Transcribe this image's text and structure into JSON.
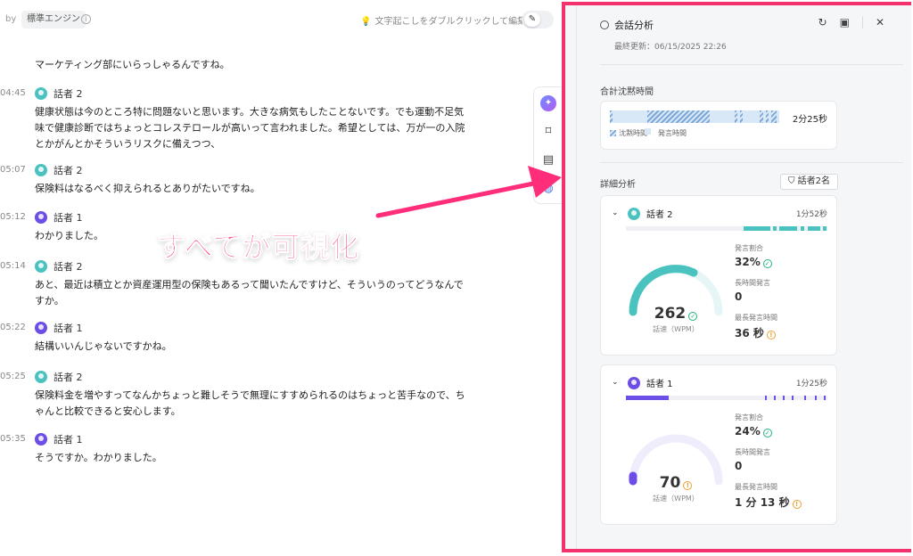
{
  "topbar": {
    "by_label": "by",
    "engine": "標準エンジン",
    "info_icon": "info-icon",
    "hint": "文字起こしをダブルクリックして編集",
    "edit_icon": "pencil-icon"
  },
  "transcript": [
    {
      "time": "",
      "speaker": "",
      "avatar": "",
      "text": "マーケティング部にいらっしゃるんですね。"
    },
    {
      "time": "04:45",
      "speaker": "話者 2",
      "avatar": "s2",
      "text": "健康状態は今のところ特に問題ないと思います。大きな病気もしたことないです。でも運動不足気味で健康診断ではちょっとコレステロールが高いって言われました。希望としては、万が一の入院とかがんとかそういうリスクに備えつつ、"
    },
    {
      "time": "05:07",
      "speaker": "話者 2",
      "avatar": "s2",
      "text": "保険料はなるべく抑えられるとありがたいですね。"
    },
    {
      "time": "05:12",
      "speaker": "話者 1",
      "avatar": "s1",
      "text": "わかりました。"
    },
    {
      "time": "05:14",
      "speaker": "話者 2",
      "avatar": "s2",
      "text": "あと、最近は積立とか資産運用型の保険もあるって聞いたんですけど、そういうのってどうなんですか。"
    },
    {
      "time": "05:22",
      "speaker": "話者 1",
      "avatar": "s1",
      "text": "結構いいんじゃないですかね。"
    },
    {
      "time": "05:25",
      "speaker": "話者 2",
      "avatar": "s2",
      "text": "保険料金を増やすってなんかちょっと難しそうで無理にすすめられるのはちょっと苦手なので、ちゃんと比較できると安心します。"
    },
    {
      "time": "05:35",
      "speaker": "話者 1",
      "avatar": "s1",
      "text": "そうですか。わかりました。"
    }
  ],
  "tools": [
    "ai-sparkle-icon",
    "bookmark-add-icon",
    "comment-icon",
    "globe-icon"
  ],
  "annotation": {
    "text": "すべてが可視化"
  },
  "panel": {
    "title": "会話分析",
    "updated": "最終更新：06/15/2025 22:26",
    "header_icons": [
      "refresh-icon",
      "message-icon",
      "close-icon"
    ],
    "silence": {
      "label": "合計沈黙時間",
      "total": "2分25秒",
      "legend_silence": "沈黙時間",
      "legend_speech": "発言時間"
    },
    "detail": {
      "label": "詳細分析",
      "filter": "話者2名"
    },
    "speakers": [
      {
        "name": "話者 2",
        "avatar": "s2",
        "duration": "1分52秒",
        "color": "#4ac3c0",
        "wpm": "262",
        "wpm_label": "話速（WPM）",
        "wpm_status": "ok",
        "ratio_label": "発言割合",
        "ratio": "32%",
        "ratio_status": "ok",
        "long_label": "長時間発言",
        "long": "0",
        "max_label": "最長発言時間",
        "max": "36 秒",
        "max_status": "warn"
      },
      {
        "name": "話者 1",
        "avatar": "s1",
        "duration": "1分25秒",
        "color": "#6c4de6",
        "wpm": "70",
        "wpm_label": "話速（WPM）",
        "wpm_status": "warn",
        "ratio_label": "発言割合",
        "ratio": "24%",
        "ratio_status": "ok",
        "long_label": "長時間発言",
        "long": "0",
        "max_label": "最長発言時間",
        "max": "1 分 13 秒",
        "max_status": "warn"
      }
    ]
  },
  "colors": {
    "accent_frame": "#f2316d",
    "annotation": "#ff2d7a",
    "speaker2": "#4ac3c0",
    "speaker1": "#6c4de6"
  }
}
